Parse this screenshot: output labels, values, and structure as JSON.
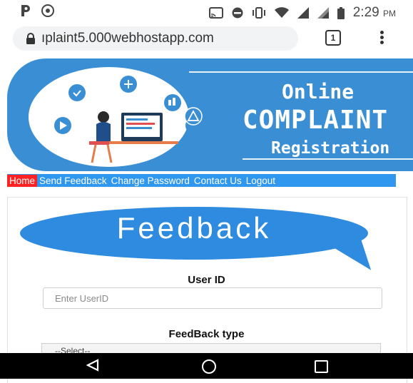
{
  "status_bar": {
    "time": "2:29",
    "ampm": "PM"
  },
  "browser": {
    "url": "ıplaint5.000webhostapp.com",
    "tab_count": "1"
  },
  "banner": {
    "title_line1": "Online",
    "title_line2": "COMPLAINT",
    "title_line3": "Registration"
  },
  "nav": {
    "items": [
      "Home",
      "Send Feedback",
      "Change Password",
      "Contact Us",
      "Logout"
    ],
    "active": "Home",
    "active_color": "#ff2222",
    "bar_color": "#2f97ee"
  },
  "feedback": {
    "heading": "Feedback",
    "user_id_label": "User ID",
    "user_id_placeholder": "Enter UserID",
    "type_label": "FeedBack type",
    "type_select_value": "--Select--"
  },
  "colors": {
    "banner": "#3a8fd4",
    "bubble": "#2f8be0"
  }
}
